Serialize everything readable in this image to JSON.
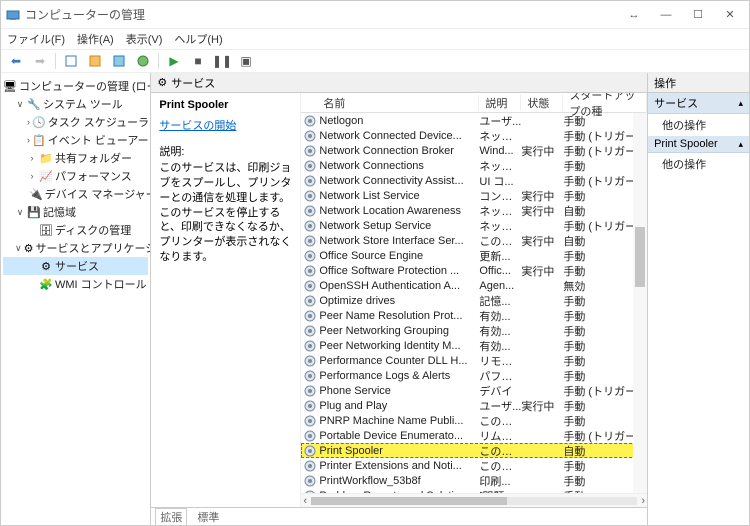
{
  "window": {
    "title": "コンピューターの管理",
    "controls": {
      "min": "—",
      "max": "☐",
      "close": "✕",
      "drag": "↔"
    }
  },
  "menu": [
    "ファイル(F)",
    "操作(A)",
    "表示(V)",
    "ヘルプ(H)"
  ],
  "tree": {
    "root": "コンピューターの管理 (ローカル)",
    "g1": "システム ツール",
    "g1a": "タスク スケジューラ",
    "g1b": "イベント ビューアー",
    "g1c": "共有フォルダー",
    "g1d": "パフォーマンス",
    "g1e": "デバイス マネージャー",
    "g2": "記憶域",
    "g2a": "ディスクの管理",
    "g3": "サービスとアプリケーション",
    "g3a": "サービス",
    "g3b": "WMI コントロール"
  },
  "center": {
    "header": "サービス",
    "service_name": "Print Spooler",
    "start_link": "サービスの開始",
    "desc_label": "説明:",
    "desc_text": "このサービスは、印刷ジョブをスプールし、プリンターとの通信を処理します。このサービスを停止すると、印刷できなくなるか、プリンターが表示されなくなります。"
  },
  "columns": {
    "name": "名前",
    "desc": "説明",
    "status": "状態",
    "startup": "スタートアップの種"
  },
  "footer": {
    "tab1": "拡張",
    "tab2": "標準"
  },
  "actions": {
    "header": "操作",
    "cat1": "サービス",
    "cat2": "Print Spooler",
    "other": "他の操作"
  },
  "services": [
    {
      "name": "Netlogon",
      "desc": "ユーザ...",
      "status": "",
      "startup": "手動"
    },
    {
      "name": "Network Connected Device...",
      "desc": "ネット...",
      "status": "",
      "startup": "手動 (トリガー開"
    },
    {
      "name": "Network Connection Broker",
      "desc": "Wind...",
      "status": "実行中",
      "startup": "手動 (トリガー開"
    },
    {
      "name": "Network Connections",
      "desc": "ネット...",
      "status": "",
      "startup": "手動"
    },
    {
      "name": "Network Connectivity Assist...",
      "desc": "UI コ...",
      "status": "",
      "startup": "手動 (トリガー開"
    },
    {
      "name": "Network List Service",
      "desc": "コンピ...",
      "status": "実行中",
      "startup": "手動"
    },
    {
      "name": "Network Location Awareness",
      "desc": "ネット...",
      "status": "実行中",
      "startup": "自動"
    },
    {
      "name": "Network Setup Service",
      "desc": "ネット...",
      "status": "",
      "startup": "手動 (トリガー開"
    },
    {
      "name": "Network Store Interface Ser...",
      "desc": "このサ...",
      "status": "実行中",
      "startup": "自動"
    },
    {
      "name": "Office  Source Engine",
      "desc": "更新...",
      "status": "",
      "startup": "手動"
    },
    {
      "name": "Office Software Protection ...",
      "desc": "Offic...",
      "status": "実行中",
      "startup": "手動"
    },
    {
      "name": "OpenSSH Authentication A...",
      "desc": "Agen...",
      "status": "",
      "startup": "無効"
    },
    {
      "name": "Optimize drives",
      "desc": "記憶...",
      "status": "",
      "startup": "手動"
    },
    {
      "name": "Peer Name Resolution Prot...",
      "desc": "有効...",
      "status": "",
      "startup": "手動"
    },
    {
      "name": "Peer Networking Grouping",
      "desc": "有効...",
      "status": "",
      "startup": "手動"
    },
    {
      "name": "Peer Networking Identity M...",
      "desc": "有効...",
      "status": "",
      "startup": "手動"
    },
    {
      "name": "Performance Counter DLL H...",
      "desc": "リモー...",
      "status": "",
      "startup": "手動"
    },
    {
      "name": "Performance Logs & Alerts",
      "desc": "パフォ...",
      "status": "",
      "startup": "手動"
    },
    {
      "name": "Phone Service",
      "desc": "デバイ",
      "status": "",
      "startup": "手動 (トリガー開"
    },
    {
      "name": "Plug and Play",
      "desc": "ユーザ...",
      "status": "実行中",
      "startup": "手動"
    },
    {
      "name": "PNRP Machine Name Publi...",
      "desc": "このサ...",
      "status": "",
      "startup": "手動"
    },
    {
      "name": "Portable Device Enumerato...",
      "desc": "リムー...",
      "status": "",
      "startup": "手動 (トリガー開"
    },
    {
      "name": "Print Spooler",
      "desc": "このサ...",
      "status": "",
      "startup": "自動",
      "highlight": true
    },
    {
      "name": "Printer Extensions and Noti...",
      "desc": "このサ...",
      "status": "",
      "startup": "手動"
    },
    {
      "name": "PrintWorkflow_53b8f",
      "desc": "印刷...",
      "status": "",
      "startup": "手動"
    },
    {
      "name": "Problem Reports and Soluti...",
      "desc": "[問題...",
      "status": "",
      "startup": "手動"
    }
  ]
}
